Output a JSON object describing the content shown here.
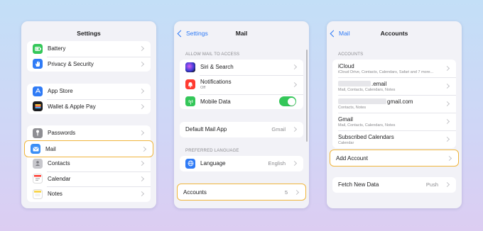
{
  "settings": {
    "title": "Settings",
    "group1": [
      {
        "label": "Battery",
        "icon": "battery-icon",
        "color": "#34c759"
      },
      {
        "label": "Privacy & Security",
        "icon": "hand-icon",
        "color": "#2f7bf6"
      }
    ],
    "group2": [
      {
        "label": "App Store",
        "icon": "app-store-icon",
        "color": "#2f7bf6"
      },
      {
        "label": "Wallet & Apple Pay",
        "icon": "wallet-icon",
        "color": "#1c1c1e"
      }
    ],
    "group3": [
      {
        "label": "Passwords",
        "icon": "key-icon",
        "color": "#8e8e93"
      },
      {
        "label": "Mail",
        "icon": "mail-icon",
        "color": "#3a8ef6"
      },
      {
        "label": "Contacts",
        "icon": "contacts-icon",
        "color": "#a2a2a7"
      },
      {
        "label": "Calendar",
        "icon": "calendar-icon",
        "color": "#ffffff"
      },
      {
        "label": "Notes",
        "icon": "notes-icon",
        "color": "#f7d34a"
      }
    ]
  },
  "mail": {
    "back": "Settings",
    "title": "Mail",
    "section_access": "ALLOW MAIL TO ACCESS",
    "siri": "Siri & Search",
    "notifications": "Notifications",
    "notifications_sub": "Off",
    "mobile_data": "Mobile Data",
    "mobile_data_on": true,
    "default_app_label": "Default Mail App",
    "default_app_value": "Gmail",
    "section_language": "PREFERRED LANGUAGE",
    "language_label": "Language",
    "language_value": "English",
    "accounts_label": "Accounts",
    "accounts_count": "5"
  },
  "accounts": {
    "back": "Mail",
    "title": "Accounts",
    "section": "ACCOUNTS",
    "items": [
      {
        "name": "iCloud",
        "sub": "iCloud Drive, Contacts, Calendars, Safari and 7 more..."
      },
      {
        "name": ".email",
        "sub": "Mail, Contacts, Calendars, Notes"
      },
      {
        "name": "gmail.com",
        "sub": "Contacts, Notes"
      },
      {
        "name": "Gmail",
        "sub": "Mail, Contacts, Calendars, Notes"
      },
      {
        "name": "Subscribed Calendars",
        "sub": "Calendar"
      }
    ],
    "add_account": "Add Account",
    "fetch_label": "Fetch New Data",
    "fetch_value": "Push"
  },
  "colors": {
    "accent": "#2f7bf6",
    "highlight": "#f0b53c",
    "toggle_on": "#34c759"
  }
}
